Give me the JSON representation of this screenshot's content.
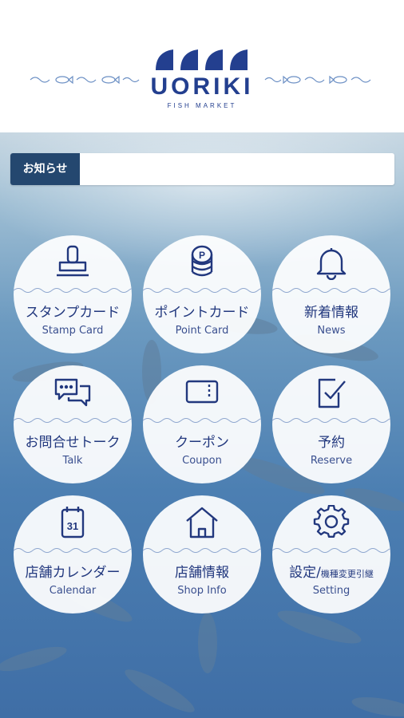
{
  "brand": {
    "name": "UORIKI",
    "sub": "FISH MARKET"
  },
  "notice": {
    "label": "お知らせ",
    "text": ""
  },
  "menu": [
    {
      "jp": "スタンプカード",
      "en": "Stamp Card",
      "icon": "stamp-icon"
    },
    {
      "jp": "ポイントカード",
      "en": "Point Card",
      "icon": "coin-stack-icon"
    },
    {
      "jp": "新着情報",
      "en": "News",
      "icon": "bell-icon"
    },
    {
      "jp": "お問合せトーク",
      "en": "Talk",
      "icon": "chat-bubbles-icon"
    },
    {
      "jp": "クーポン",
      "en": "Coupon",
      "icon": "ticket-icon"
    },
    {
      "jp": "予約",
      "en": "Reserve",
      "icon": "clipboard-check-icon"
    },
    {
      "jp": "店舗カレンダー",
      "en": "Calendar",
      "icon": "calendar-icon",
      "day": "31"
    },
    {
      "jp": "店舗情報",
      "en": "Shop Info",
      "icon": "house-icon"
    },
    {
      "jp": "設定/",
      "jp_small": "機種変更引継",
      "en": "Setting",
      "icon": "gear-icon"
    }
  ],
  "colors": {
    "brand": "#233f8f",
    "notice_label_bg": "#24476f",
    "icon": "#22387e"
  }
}
